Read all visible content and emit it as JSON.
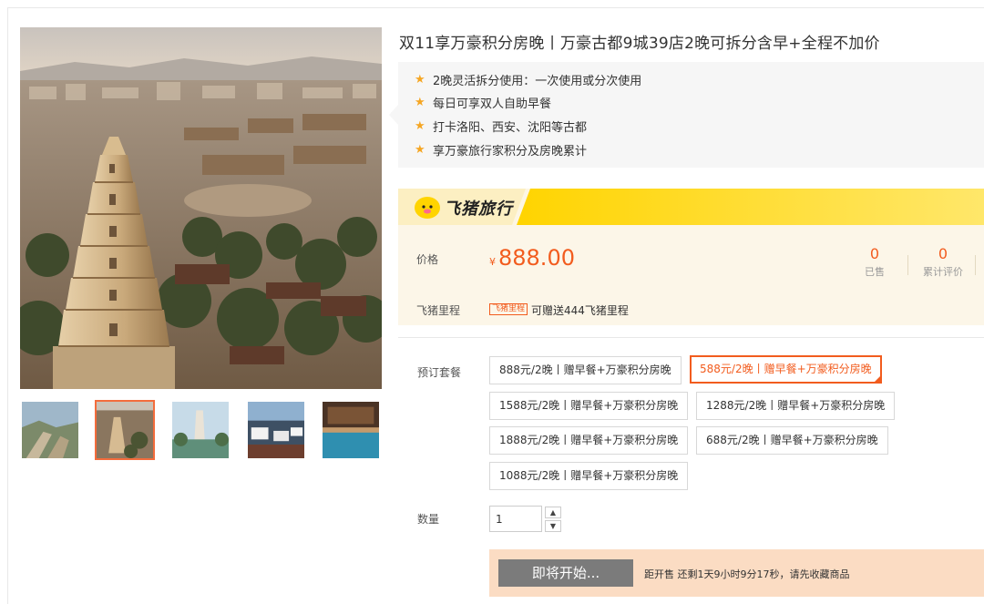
{
  "product": {
    "title": "双11享万豪积分房晚丨万豪古都9城39店2晚可拆分含早+全程不加价"
  },
  "features": [
    "2晚灵活拆分使用：一次使用或分次使用",
    "每日可享双人自助早餐",
    "打卡洛阳、西安、沈阳等古都",
    "享万豪旅行家积分及房晚累计"
  ],
  "brand": {
    "name": "飞猪旅行",
    "accent": "#ffd400"
  },
  "price": {
    "label": "价格",
    "currency": "¥",
    "value": "888.00",
    "sold_count": "0",
    "sold_label": "已售",
    "review_count": "0",
    "review_label": "累计评价"
  },
  "miles": {
    "label": "飞猪里程",
    "tag": "飞猪里程",
    "text": "可赠送444飞猪里程"
  },
  "packages": {
    "label": "预订套餐",
    "options": [
      "888元/2晚丨赠早餐+万豪积分房晚",
      "588元/2晚丨赠早餐+万豪积分房晚",
      "1588元/2晚丨赠早餐+万豪积分房晚",
      "1288元/2晚丨赠早餐+万豪积分房晚",
      "1888元/2晚丨赠早餐+万豪积分房晚",
      "688元/2晚丨赠早餐+万豪积分房晚",
      "1088元/2晚丨赠早餐+万豪积分房晚"
    ],
    "selected": "588元/2晚丨赠早餐+万豪积分房晚"
  },
  "quantity": {
    "label": "数量",
    "value": "1"
  },
  "buy": {
    "button": "即将开始...",
    "note": "距开售 还剩1天9小时9分17秒，请先收藏商品"
  },
  "gallery": {
    "icons": [
      "great-wall-photo",
      "pagoda-photo",
      "tower-lake-photo",
      "restaurant-photo",
      "pool-photo"
    ],
    "active_index": 1
  },
  "colors": {
    "price": "#f25c1e",
    "star": "#f5a623",
    "buy_bar": "#fbdcc3",
    "buy_button": "#7b7b7b"
  }
}
